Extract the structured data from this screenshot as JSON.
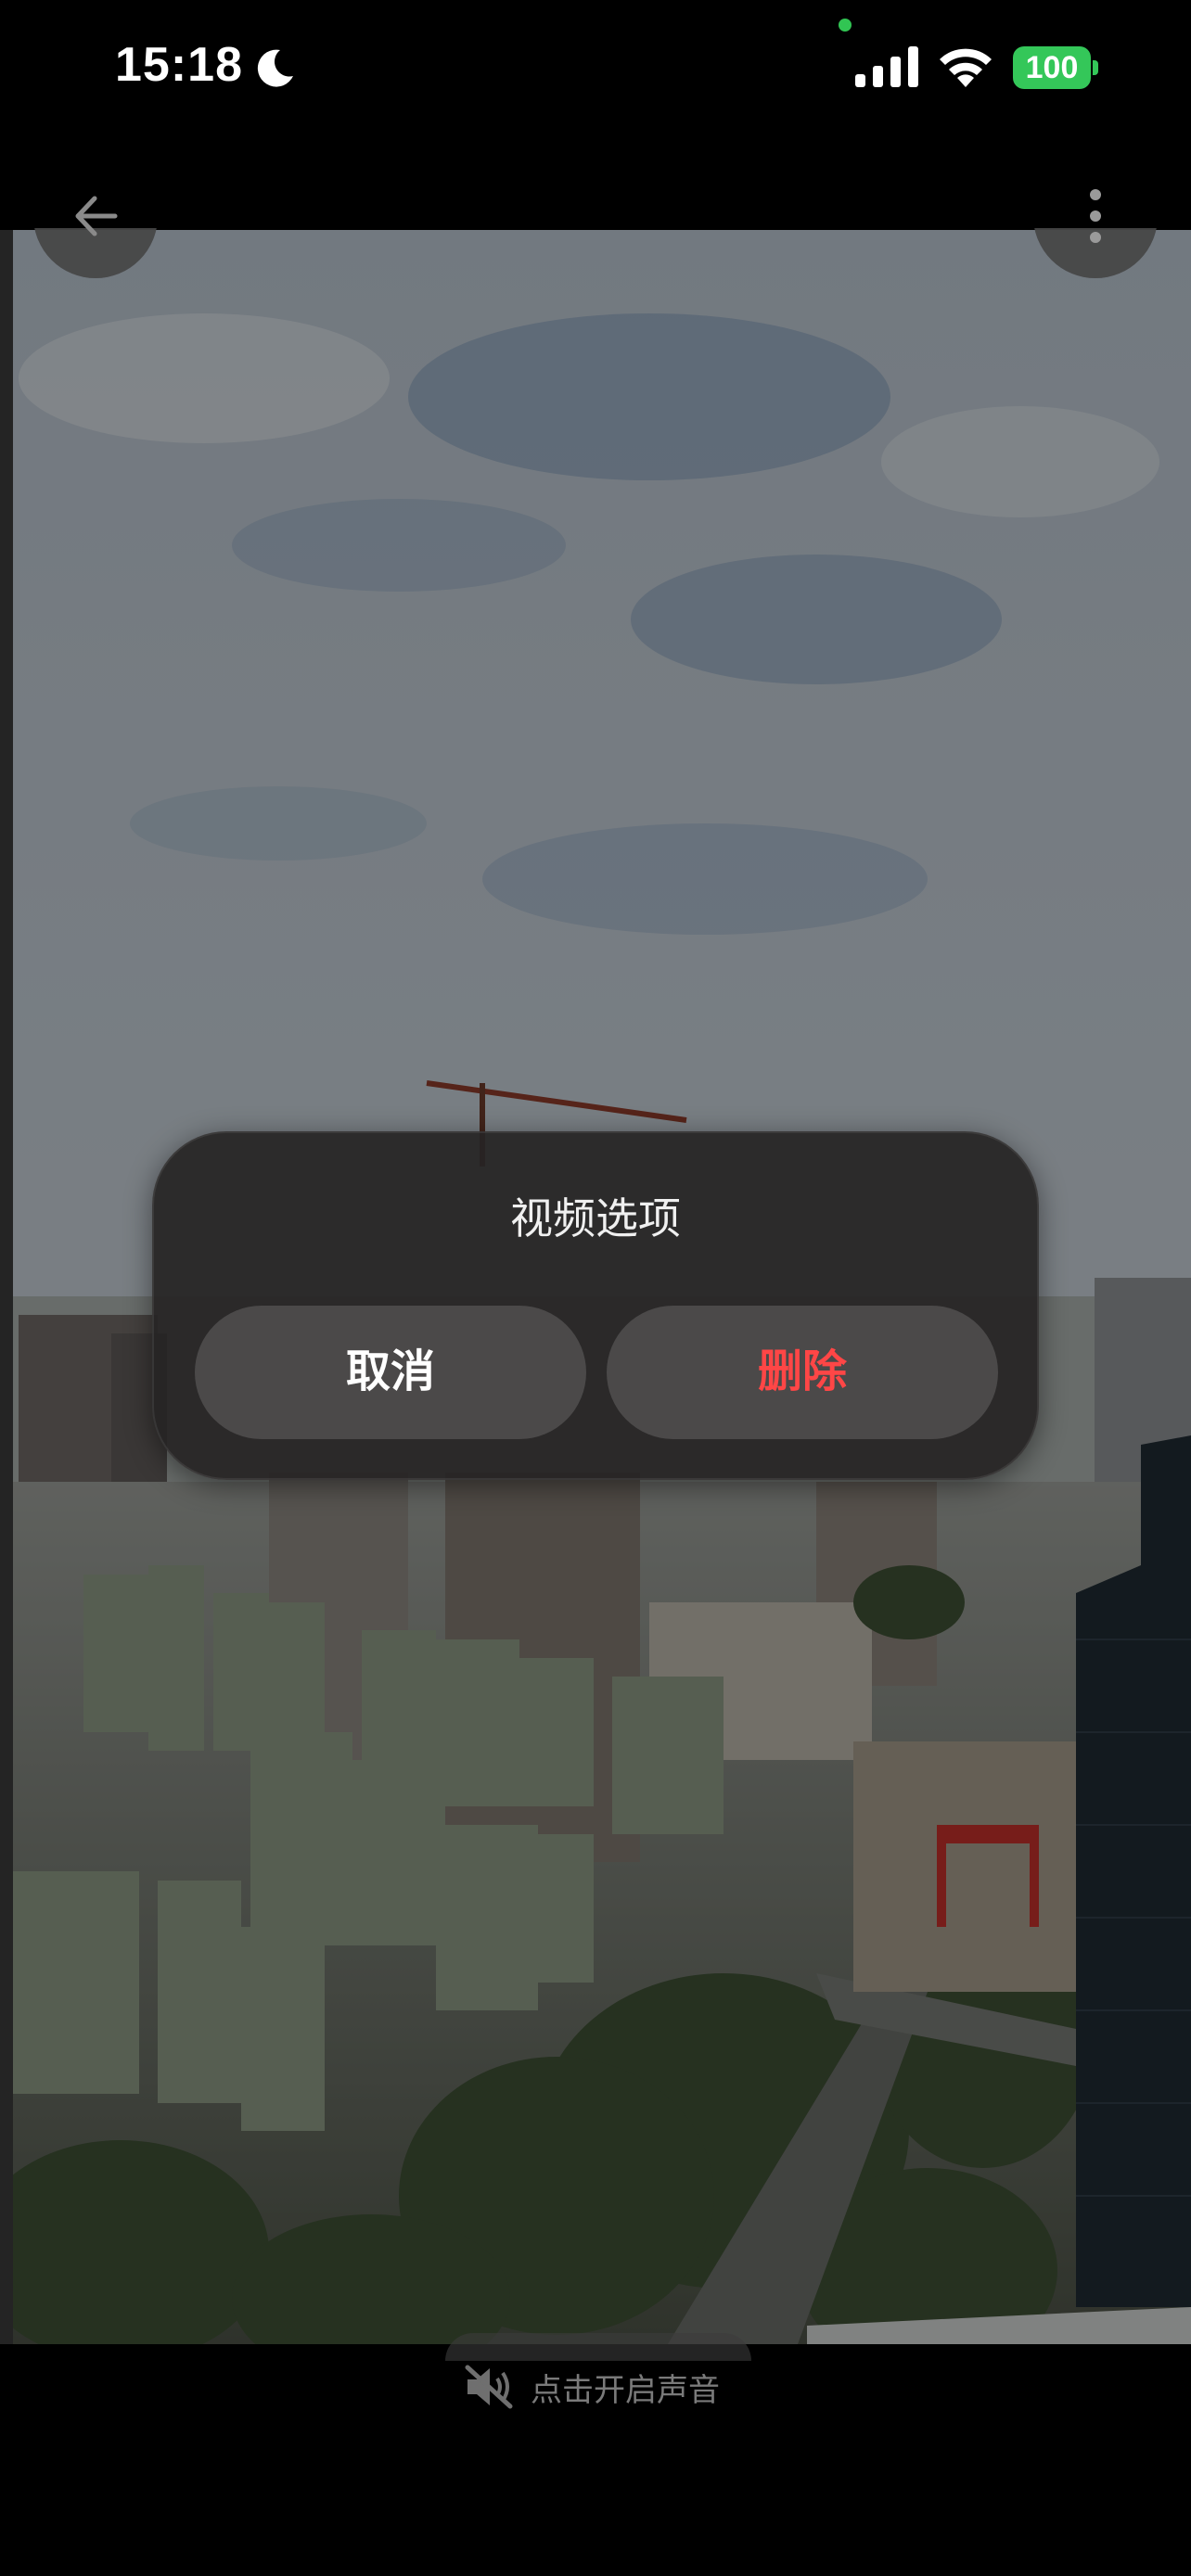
{
  "status_bar": {
    "time": "15:18",
    "battery": "100",
    "colors": {
      "battery": "#34c759",
      "camera_indicator": "#31c553"
    }
  },
  "media": {
    "icons": [
      "arrow-left-icon",
      "more-vertical-icon"
    ]
  },
  "dialog": {
    "title": "视频选项",
    "cancel_label": "取消",
    "delete_label": "删除",
    "colors": {
      "delete": "#ff4646"
    }
  },
  "sound_hint": {
    "label": "点击开启声音",
    "icon": "mute-icon"
  }
}
